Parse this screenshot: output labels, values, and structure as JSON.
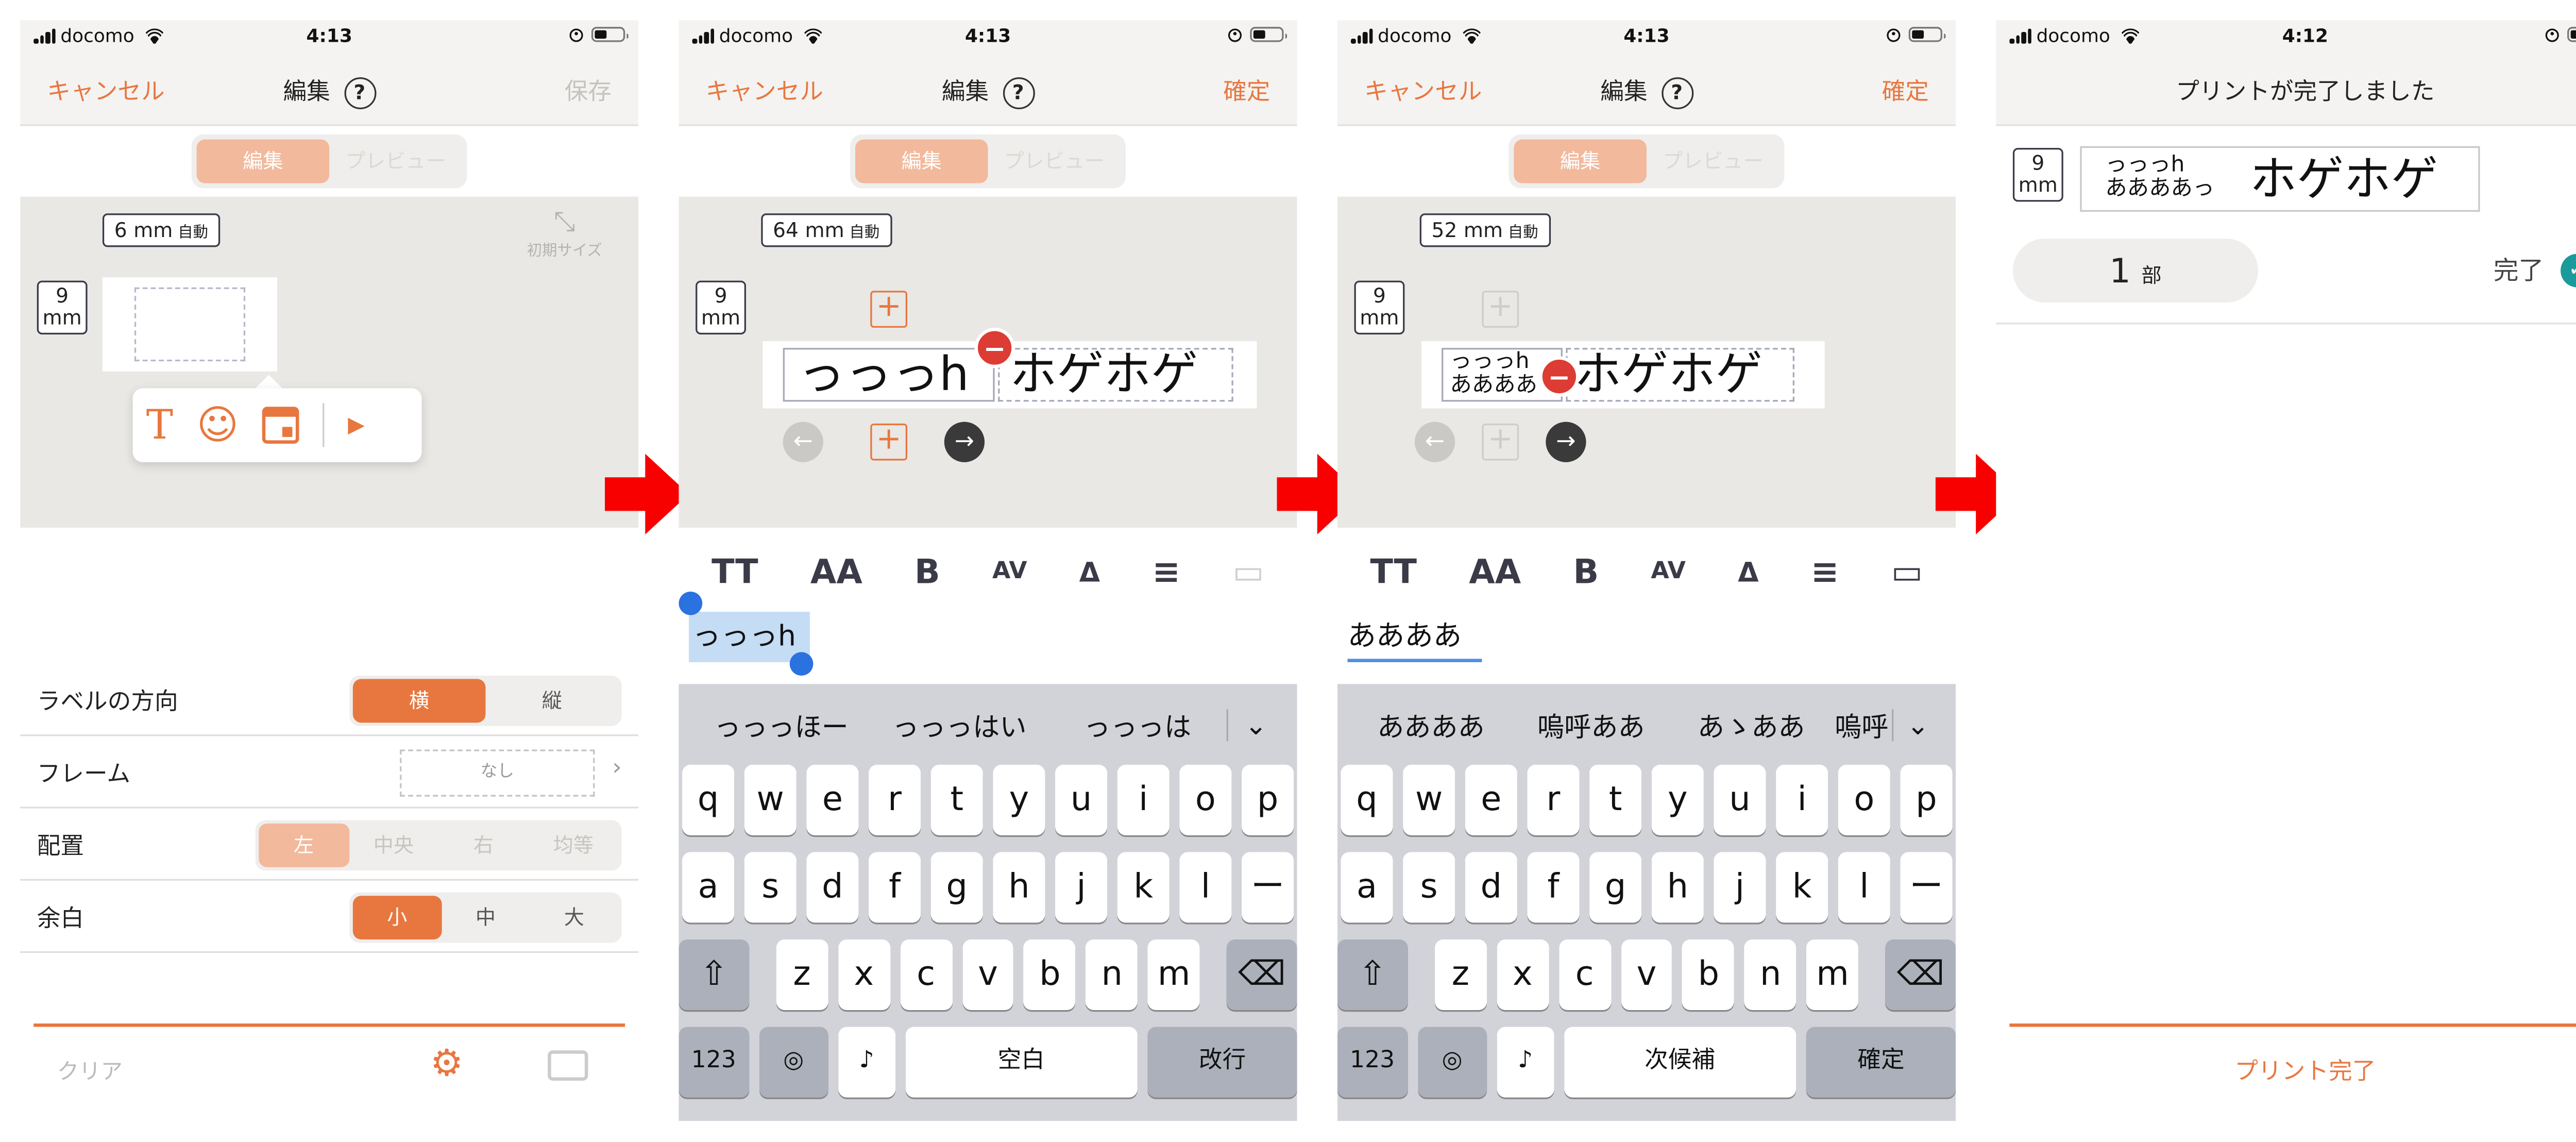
{
  "status_bar": {
    "carrier": "docomo",
    "time_1": "4:13",
    "time_2": "4:13",
    "time_3": "4:13",
    "time_4": "4:12"
  },
  "screen1": {
    "cancel": "キャンセル",
    "title": "編集",
    "save": "保存",
    "tab_edit": "編集",
    "tab_preview": "プレビュー",
    "length": "6",
    "length_unit": "mm",
    "length_auto": "自動",
    "height": "9",
    "height_unit": "mm",
    "reset_size": "初期サイズ",
    "settings": [
      {
        "label": "ラベルの方向",
        "options": [
          "横",
          "縦"
        ]
      },
      {
        "label": "フレーム",
        "value": "なし"
      },
      {
        "label": "配置",
        "options": [
          "左",
          "中央",
          "右",
          "均等"
        ]
      },
      {
        "label": "余白",
        "options": [
          "小",
          "中",
          "大"
        ]
      }
    ],
    "clear": "クリア"
  },
  "screen2": {
    "cancel": "キャンセル",
    "title": "編集",
    "confirm": "確定",
    "tab_edit": "編集",
    "tab_preview": "プレビュー",
    "length": "64",
    "length_unit": "mm",
    "length_auto": "自動",
    "height": "9",
    "height_unit": "mm",
    "block1": "っっっh",
    "block2": "ホゲホゲ",
    "input": "っっっh",
    "suggestions": [
      "っっっほー",
      "っっっはい",
      "っっっは"
    ],
    "return_key": "改行"
  },
  "screen3": {
    "cancel": "キャンセル",
    "title": "編集",
    "confirm": "確定",
    "tab_edit": "編集",
    "tab_preview": "プレビュー",
    "length": "52",
    "length_unit": "mm",
    "length_auto": "自動",
    "height": "9",
    "height_unit": "mm",
    "block1_line1": "っっっh",
    "block1_line2": "ああああ",
    "block2": "ホゲホゲ",
    "input": "ああああ",
    "suggestions": [
      "ああああ",
      "嗚呼ああ",
      "あゝああ",
      "嗚呼"
    ],
    "space_key": "次候補",
    "return_key": "確定"
  },
  "screen4": {
    "title": "プリントが完了しました",
    "height": "9",
    "height_unit": "mm",
    "line1": "っっっh",
    "line2": "ああああっ",
    "main": "ホゲホゲ",
    "copies": "1",
    "copies_unit": "部",
    "done": "完了",
    "footer": "プリント完了"
  },
  "keyboard": {
    "row1": [
      "q",
      "w",
      "e",
      "r",
      "t",
      "y",
      "u",
      "i",
      "o",
      "p"
    ],
    "row2": [
      "a",
      "s",
      "d",
      "f",
      "g",
      "h",
      "j",
      "k",
      "l",
      "ー"
    ],
    "row3": [
      "z",
      "x",
      "c",
      "v",
      "b",
      "n",
      "m"
    ],
    "num": "123",
    "space": "空白"
  },
  "colors": {
    "accent": "#e8773f",
    "accent_light": "#f2b99c",
    "delete": "#dc3c33",
    "done_check": "#1a9a9a"
  }
}
